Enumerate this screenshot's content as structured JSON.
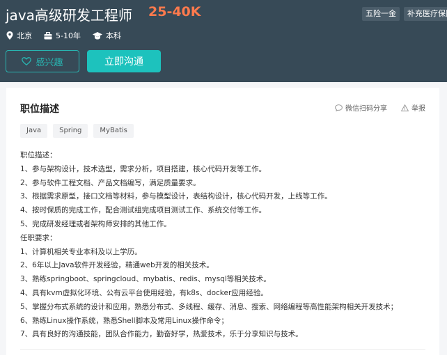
{
  "job": {
    "title": "java高级研发工程师",
    "salary": "25-40K",
    "benefits": [
      "五险一金",
      "补充医疗保险"
    ],
    "meta": {
      "location": "北京",
      "experience": "5-10年",
      "education": "本科"
    }
  },
  "actions": {
    "interest_label": "感兴趣",
    "chat_label": "立即沟通"
  },
  "description": {
    "section_title": "职位描述",
    "share_label": "微信扫码分享",
    "report_label": "举报",
    "tags": [
      "Java",
      "Spring",
      "MyBatis"
    ],
    "lines": [
      "职位描述：",
      "1、参与架构设计，技术选型，需求分析，项目搭建，核心代码开发等工作。",
      "2、参与软件工程文档、产品文档编写，满足质量要求。",
      "3、根据需求原型，接口文档等材料，参与模型设计，表结构设计，核心代码开发，上线等工作。",
      "4、按时保质的完成工作，配合测试组完成项目测试工作、系统交付等工作。",
      "5、完成研发经理或者架构师安排的其他工作。",
      "任职要求：",
      "1、计算机相关专业本科及以上学历。",
      "2、6年以上Java软件开发经验，精通web开发的相关技术。",
      "3、熟练springboot、springcloud、mybatis、redis、mysql等相关技术。",
      "4、具有kvm虚拟化环境、公有云平台使用经验，有k8s、docker应用经验。",
      "5、掌握分布式系统的设计和应用，熟悉分布式、多线程、缓存、消息、搜索、网络编程等高性能架构相关开发技术；",
      "6、熟练Linux操作系统，熟悉Shell脚本及常用Linux操作命令；",
      "7、具有良好的沟通技能，团队合作能力，勤奋好学，热爱技术，乐于分享知识与技术。"
    ]
  },
  "colors": {
    "header_bg": "#374a57",
    "accent": "#1dc2bd",
    "salary": "#ff7a4d"
  }
}
